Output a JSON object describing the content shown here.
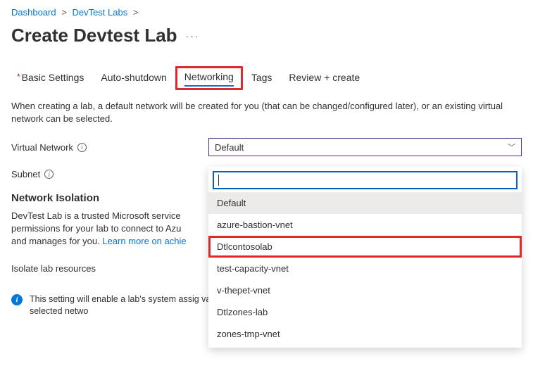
{
  "breadcrumb": {
    "items": [
      "Dashboard",
      "DevTest Labs"
    ],
    "sep": ">"
  },
  "page_title": "Create Devtest Lab",
  "more_glyph": "···",
  "tabs": [
    {
      "label": "Basic Settings",
      "required": true,
      "active": false
    },
    {
      "label": "Auto-shutdown",
      "required": false,
      "active": false
    },
    {
      "label": "Networking",
      "required": false,
      "active": true,
      "highlighted": true
    },
    {
      "label": "Tags",
      "required": false,
      "active": false
    },
    {
      "label": "Review + create",
      "required": false,
      "active": false
    }
  ],
  "networking": {
    "description": "When creating a lab, a default network will be created for you (that can be changed/configured later), or an existing virtual network can be selected.",
    "vnet_label": "Virtual Network",
    "vnet_value": "Default",
    "subnet_label": "Subnet",
    "isolation_title": "Network Isolation",
    "isolation_desc_prefix": "DevTest Lab is a trusted Microsoft service ",
    "isolation_desc_mid": "permissions for your lab to connect to Azu",
    "isolation_desc_suffix": "and manages for you. ",
    "isolation_link": "Learn more on achie",
    "isolate_label": "Isolate lab resources",
    "note_text": "This setting will enable a lab's system assig\nvaults will be isolated to the selected netwo"
  },
  "dropdown": {
    "search_value": "",
    "options": [
      {
        "label": "Default",
        "selected": true
      },
      {
        "label": "azure-bastion-vnet"
      },
      {
        "label": "Dtlcontosolab",
        "highlighted": true
      },
      {
        "label": "test-capacity-vnet"
      },
      {
        "label": "v-thepet-vnet"
      },
      {
        "label": "Dtlzones-lab"
      },
      {
        "label": "zones-tmp-vnet"
      }
    ]
  }
}
